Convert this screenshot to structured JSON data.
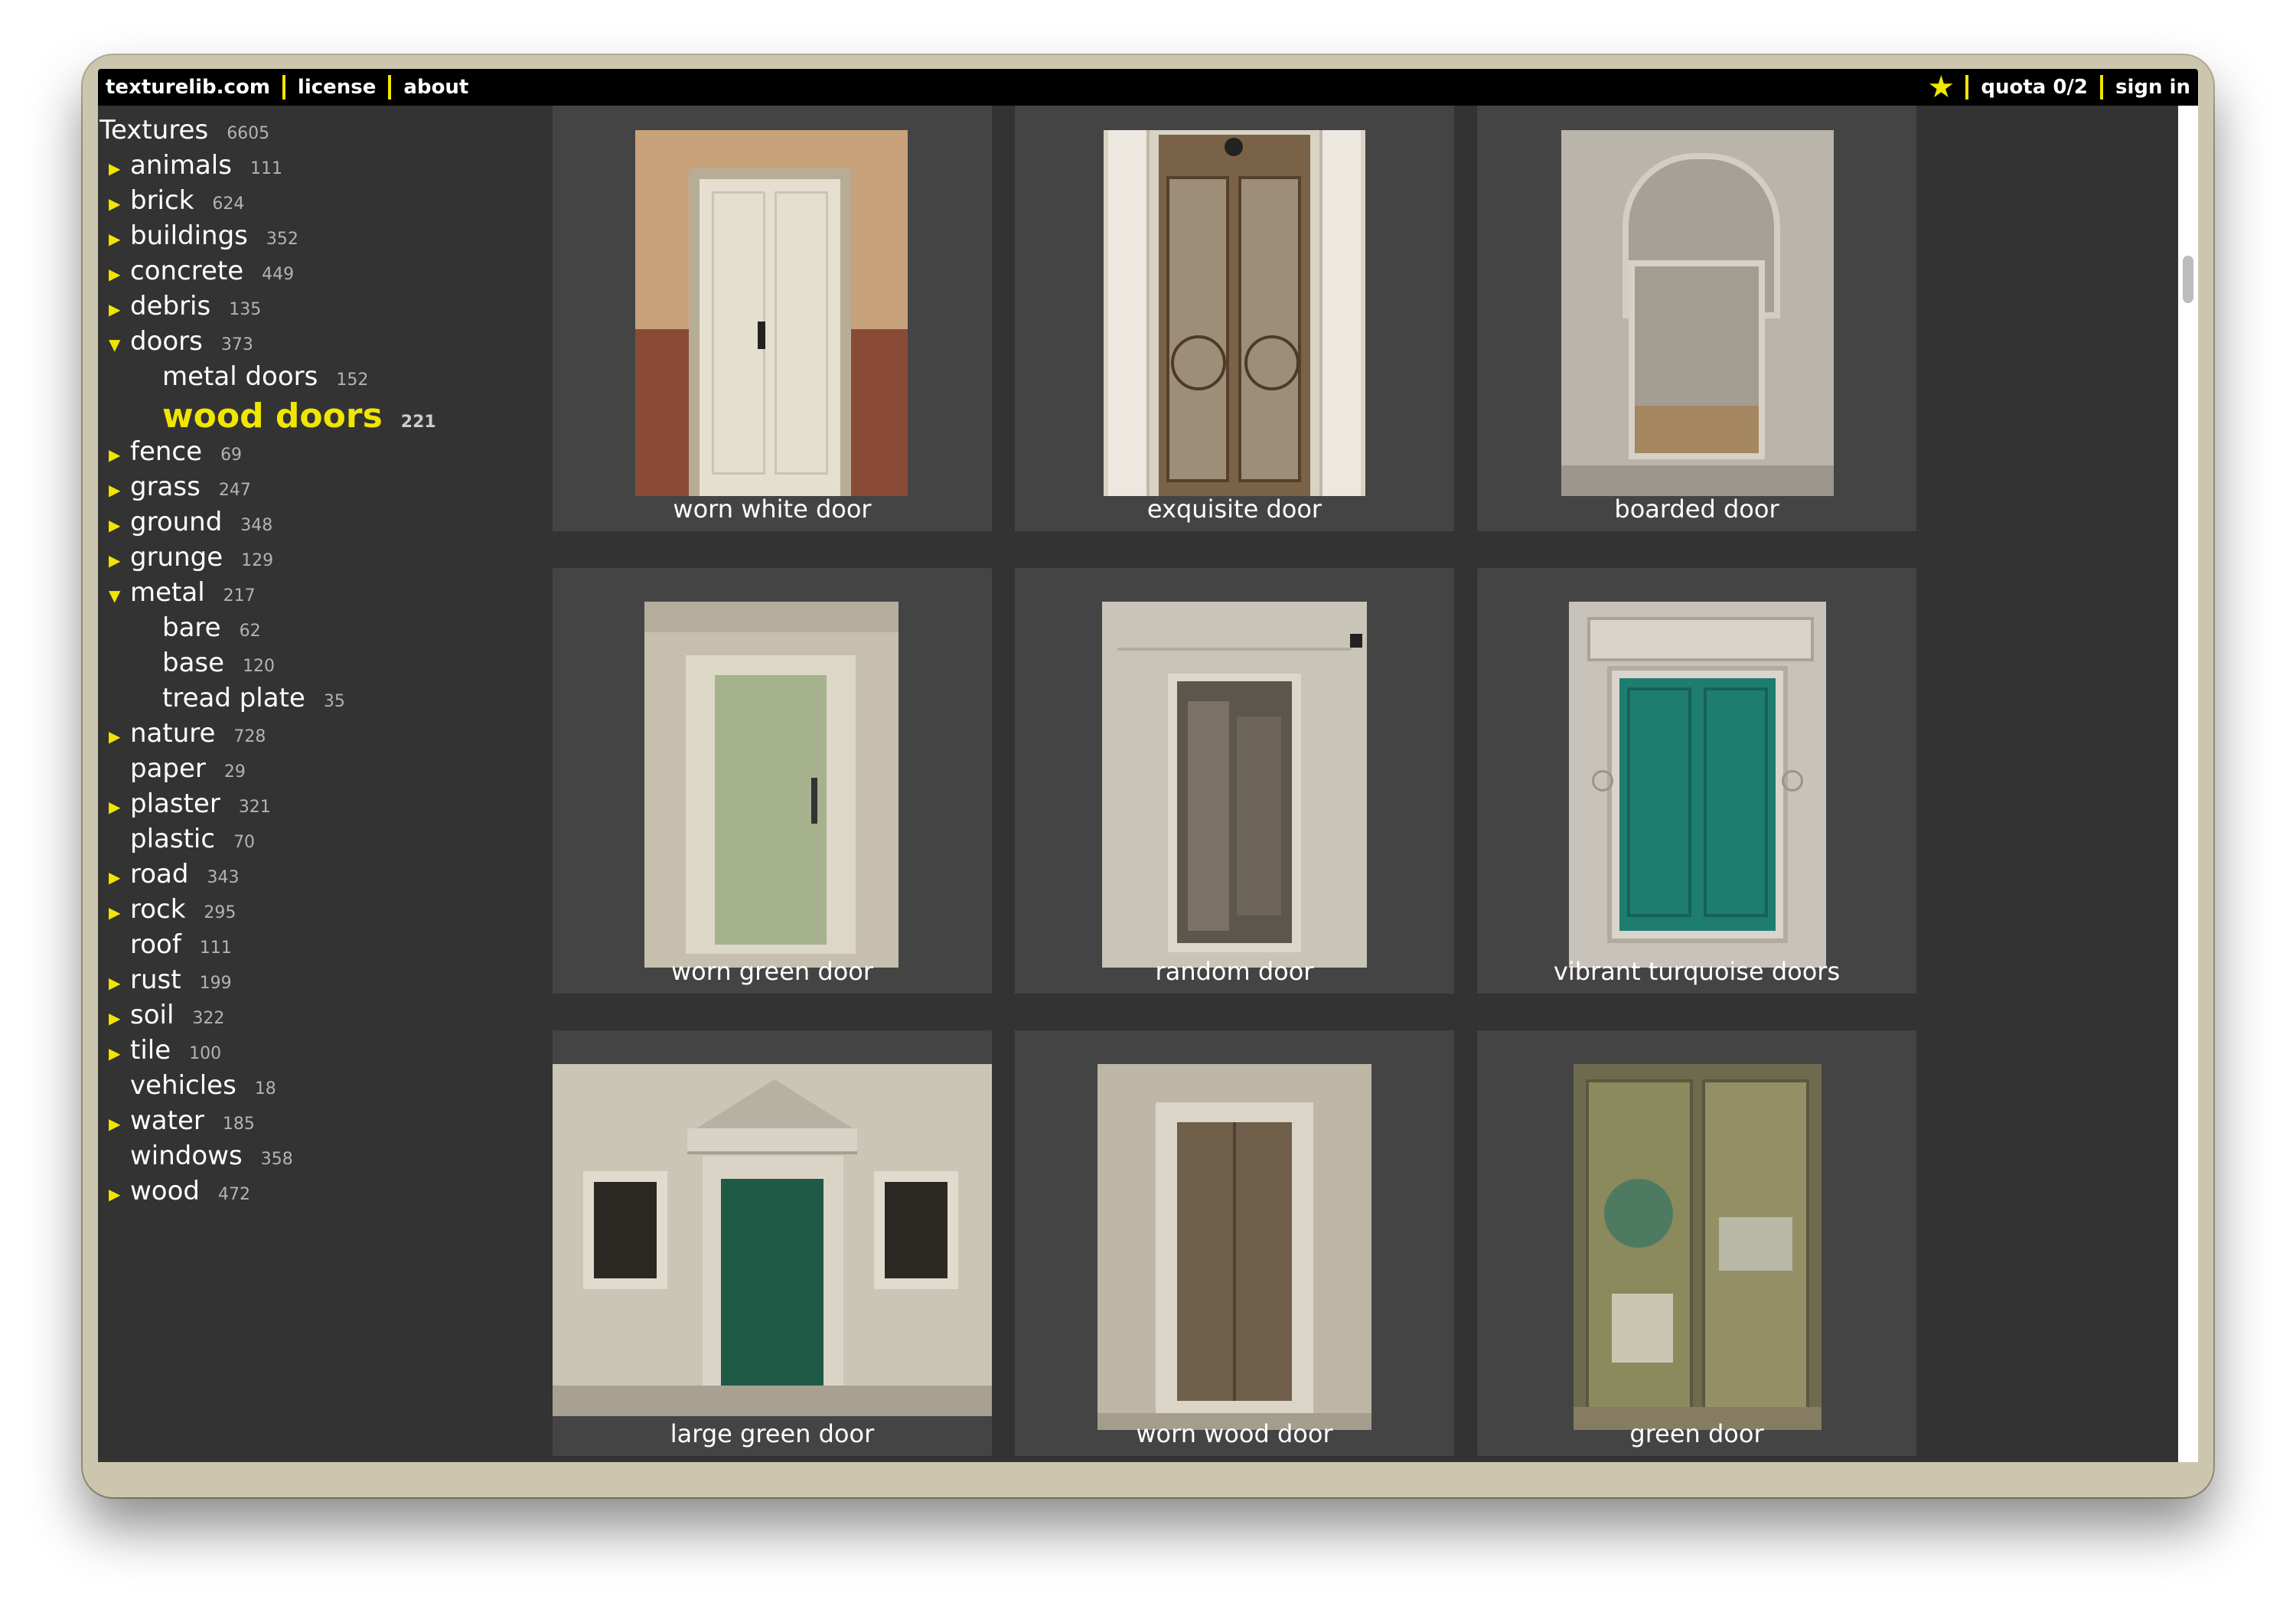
{
  "topbar": {
    "site": "texturelib.com",
    "license": "license",
    "about": "about",
    "quota": "quota 0/2",
    "sign_in": "sign in",
    "accent_color": "#f0e600",
    "star_icon": "star-icon"
  },
  "sidebar": {
    "root": {
      "label": "Textures",
      "count": "6605"
    },
    "items": [
      {
        "label": "animals",
        "count": "111"
      },
      {
        "label": "brick",
        "count": "624"
      },
      {
        "label": "buildings",
        "count": "352"
      },
      {
        "label": "concrete",
        "count": "449"
      },
      {
        "label": "debris",
        "count": "135"
      },
      {
        "label": "doors",
        "count": "373",
        "expanded": true,
        "children": [
          {
            "label": "metal doors",
            "count": "152"
          },
          {
            "label": "wood doors",
            "count": "221",
            "selected": true
          }
        ]
      },
      {
        "label": "fence",
        "count": "69"
      },
      {
        "label": "grass",
        "count": "247"
      },
      {
        "label": "ground",
        "count": "348"
      },
      {
        "label": "grunge",
        "count": "129"
      },
      {
        "label": "metal",
        "count": "217",
        "expanded": true,
        "children": [
          {
            "label": "bare",
            "count": "62"
          },
          {
            "label": "base",
            "count": "120"
          },
          {
            "label": "tread plate",
            "count": "35"
          }
        ]
      },
      {
        "label": "nature",
        "count": "728"
      },
      {
        "label": "paper",
        "count": "29",
        "leaf": true
      },
      {
        "label": "plaster",
        "count": "321"
      },
      {
        "label": "plastic",
        "count": "70",
        "leaf": true
      },
      {
        "label": "road",
        "count": "343"
      },
      {
        "label": "rock",
        "count": "295"
      },
      {
        "label": "roof",
        "count": "111",
        "leaf": true
      },
      {
        "label": "rust",
        "count": "199"
      },
      {
        "label": "soil",
        "count": "322"
      },
      {
        "label": "tile",
        "count": "100"
      },
      {
        "label": "vehicles",
        "count": "18",
        "leaf": true
      },
      {
        "label": "water",
        "count": "185"
      },
      {
        "label": "windows",
        "count": "358",
        "leaf": true
      },
      {
        "label": "wood",
        "count": "472"
      }
    ]
  },
  "gallery": {
    "cards": [
      {
        "title": "worn white door"
      },
      {
        "title": "exquisite door"
      },
      {
        "title": "boarded door"
      },
      {
        "title": "worn green door"
      },
      {
        "title": "random door"
      },
      {
        "title": "vibrant turquoise doors"
      },
      {
        "title": "large green door"
      },
      {
        "title": "worn wood door"
      },
      {
        "title": "green door"
      }
    ]
  }
}
